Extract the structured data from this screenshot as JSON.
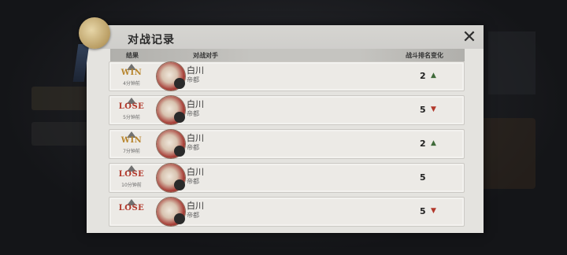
{
  "window": {
    "title": "对战记录",
    "close_icon": "close-icon"
  },
  "columns": {
    "result": "结果",
    "opponent": "对战对手",
    "rank_change": "战斗排名变化"
  },
  "records": [
    {
      "result": "WIN",
      "result_type": "win",
      "time": "4分钟前",
      "opponent_name": "白川",
      "opponent_server": "帝都",
      "rank": "2",
      "direction": "up",
      "arrow": "▲"
    },
    {
      "result": "LOSE",
      "result_type": "lose",
      "time": "5分钟前",
      "opponent_name": "白川",
      "opponent_server": "帝都",
      "rank": "5",
      "direction": "down",
      "arrow": "▼"
    },
    {
      "result": "WIN",
      "result_type": "win",
      "time": "7分钟前",
      "opponent_name": "白川",
      "opponent_server": "帝都",
      "rank": "2",
      "direction": "up",
      "arrow": "▲"
    },
    {
      "result": "LOSE",
      "result_type": "lose",
      "time": "10分钟前",
      "opponent_name": "白川",
      "opponent_server": "帝都",
      "rank": "5",
      "direction": "none",
      "arrow": ""
    },
    {
      "result": "LOSE",
      "result_type": "lose",
      "time": "",
      "opponent_name": "白川",
      "opponent_server": "帝都",
      "rank": "5",
      "direction": "down",
      "arrow": "▼"
    }
  ],
  "colors": {
    "win": "#b8862e",
    "lose": "#b2382b",
    "up": "#3f6a3a",
    "down": "#b2382b"
  }
}
